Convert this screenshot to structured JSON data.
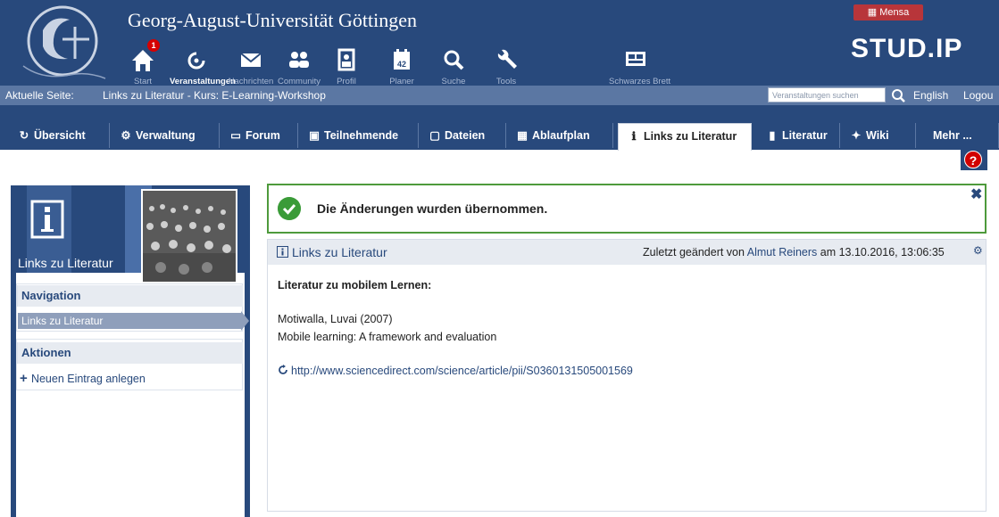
{
  "header": {
    "university": "Georg-August-Universität Göttingen",
    "mensa": "Mensa",
    "brand": "STUD.IP",
    "start_badge": "1",
    "nav": [
      {
        "label": "Start",
        "icon": "home-icon"
      },
      {
        "label": "Veranstaltungen",
        "icon": "courses-icon"
      },
      {
        "label": "Nachrichten",
        "icon": "mail-icon"
      },
      {
        "label": "Community",
        "icon": "community-icon"
      },
      {
        "label": "Profil",
        "icon": "profile-icon"
      },
      {
        "label": "Planer",
        "icon": "calendar-icon"
      },
      {
        "label": "Suche",
        "icon": "search-icon"
      },
      {
        "label": "Tools",
        "icon": "wrench-icon"
      },
      {
        "label": "Schwarzes Brett",
        "icon": "board-icon"
      }
    ]
  },
  "crumbbar": {
    "label": "Aktuelle Seite:",
    "value": "Links zu Literatur - Kurs: E-Learning-Workshop",
    "search_placeholder": "Veranstaltungen suchen",
    "language": "English",
    "logout": "Logou"
  },
  "tabs": [
    {
      "label": "Übersicht",
      "icon": "overview-icon",
      "glyph": "↻"
    },
    {
      "label": "Verwaltung",
      "icon": "admin-icon",
      "glyph": "⚙"
    },
    {
      "label": "Forum",
      "icon": "forum-icon",
      "glyph": "▭"
    },
    {
      "label": "Teilnehmende",
      "icon": "participants-icon",
      "glyph": "▣"
    },
    {
      "label": "Dateien",
      "icon": "files-icon",
      "glyph": "▢"
    },
    {
      "label": "Ablaufplan",
      "icon": "schedule-icon",
      "glyph": "▦"
    },
    {
      "label": "Links zu Literatur",
      "icon": "info-icon",
      "glyph": "ℹ"
    },
    {
      "label": "Literatur",
      "icon": "book-icon",
      "glyph": "▮"
    },
    {
      "label": "Wiki",
      "icon": "wiki-icon",
      "glyph": "✦"
    },
    {
      "label": "Mehr ...",
      "icon": "",
      "glyph": ""
    }
  ],
  "sidebar": {
    "title": "Links zu Literatur",
    "nav_heading": "Navigation",
    "nav_item": "Links zu Literatur",
    "actions_heading": "Aktionen",
    "action_item": "Neuen Eintrag anlegen"
  },
  "message": {
    "text": "Die Änderungen wurden übernommen.",
    "type": "success"
  },
  "panel": {
    "title": "Links zu Literatur",
    "meta_prefix": "Zuletzt geändert von",
    "meta_author": "Almut Reiners",
    "meta_date": "am 13.10.2016, 13:06:35",
    "heading": "Literatur zu mobilem Lernen:",
    "author_line": "Motiwalla, Luvai (2007)",
    "title_line": "Mobile learning: A framework and evaluation",
    "link": "http://www.sciencedirect.com/science/article/pii/S0360131505001569"
  },
  "colors": {
    "header": "#28497c",
    "crumbbar": "#5b77a3",
    "success": "#3a9b38",
    "mensa": "#b8353a"
  }
}
